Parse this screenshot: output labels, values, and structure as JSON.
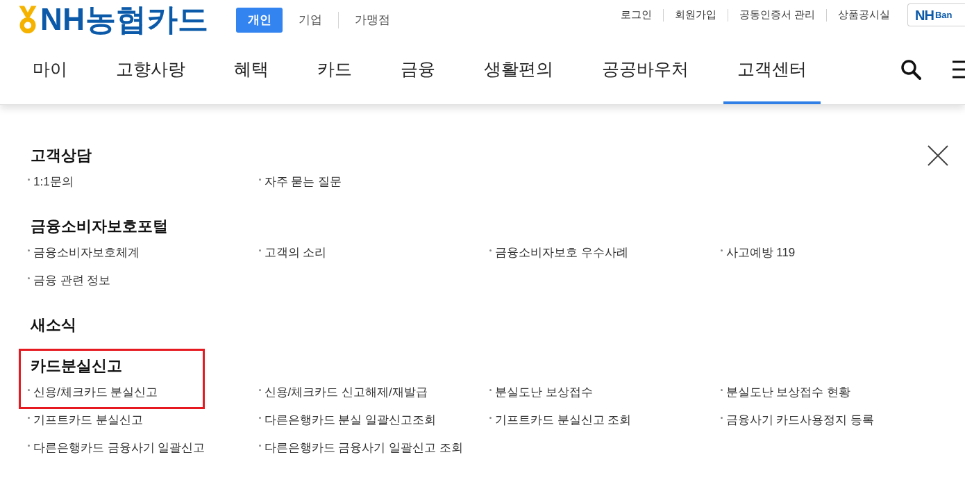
{
  "header": {
    "logo": {
      "text": "NH농협카드"
    },
    "segments": [
      {
        "label": "개인",
        "selected": true
      },
      {
        "label": "기업",
        "selected": false
      },
      {
        "label": "가맹점",
        "selected": false
      }
    ],
    "utility_links": [
      "로그인",
      "회원가입",
      "공동인증서 관리",
      "상품공시실"
    ],
    "bank_button": {
      "prefix": "NH",
      "text": "Ban"
    }
  },
  "nav": {
    "items": [
      {
        "label": "마이",
        "selected": false
      },
      {
        "label": "고향사랑",
        "selected": false
      },
      {
        "label": "혜택",
        "selected": false
      },
      {
        "label": "카드",
        "selected": false
      },
      {
        "label": "금융",
        "selected": false
      },
      {
        "label": "생활편의",
        "selected": false
      },
      {
        "label": "공공바우처",
        "selected": false
      },
      {
        "label": "고객센터",
        "selected": true
      }
    ]
  },
  "menu_panel": {
    "sections": [
      {
        "title": "고객상담",
        "highlighted": false,
        "items": [
          "1:1문의",
          "자주 묻는 질문"
        ]
      },
      {
        "title": "금융소비자보호포털",
        "highlighted": false,
        "items": [
          "금융소비자보호체계",
          "고객의 소리",
          "금융소비자보호 우수사례",
          "사고예방 119",
          "금융 관련 정보"
        ]
      },
      {
        "title": "새소식",
        "highlighted": false
      },
      {
        "title": "카드분실신고",
        "highlighted": true,
        "items": [
          "신용/체크카드 분실신고",
          "신용/체크카드 신고해제/재발급",
          "분실도난 보상접수",
          "분실도난 보상접수 현황",
          "기프트카드 분실신고",
          "다른은행카드 분실 일괄신고조회",
          "기프트카드 분실신고 조회",
          "금융사기 카드사용정지 등록",
          "다른은행카드 금융사기 일괄신고",
          "다른은행카드 금융사기 일괄신고 조회"
        ]
      }
    ]
  }
}
